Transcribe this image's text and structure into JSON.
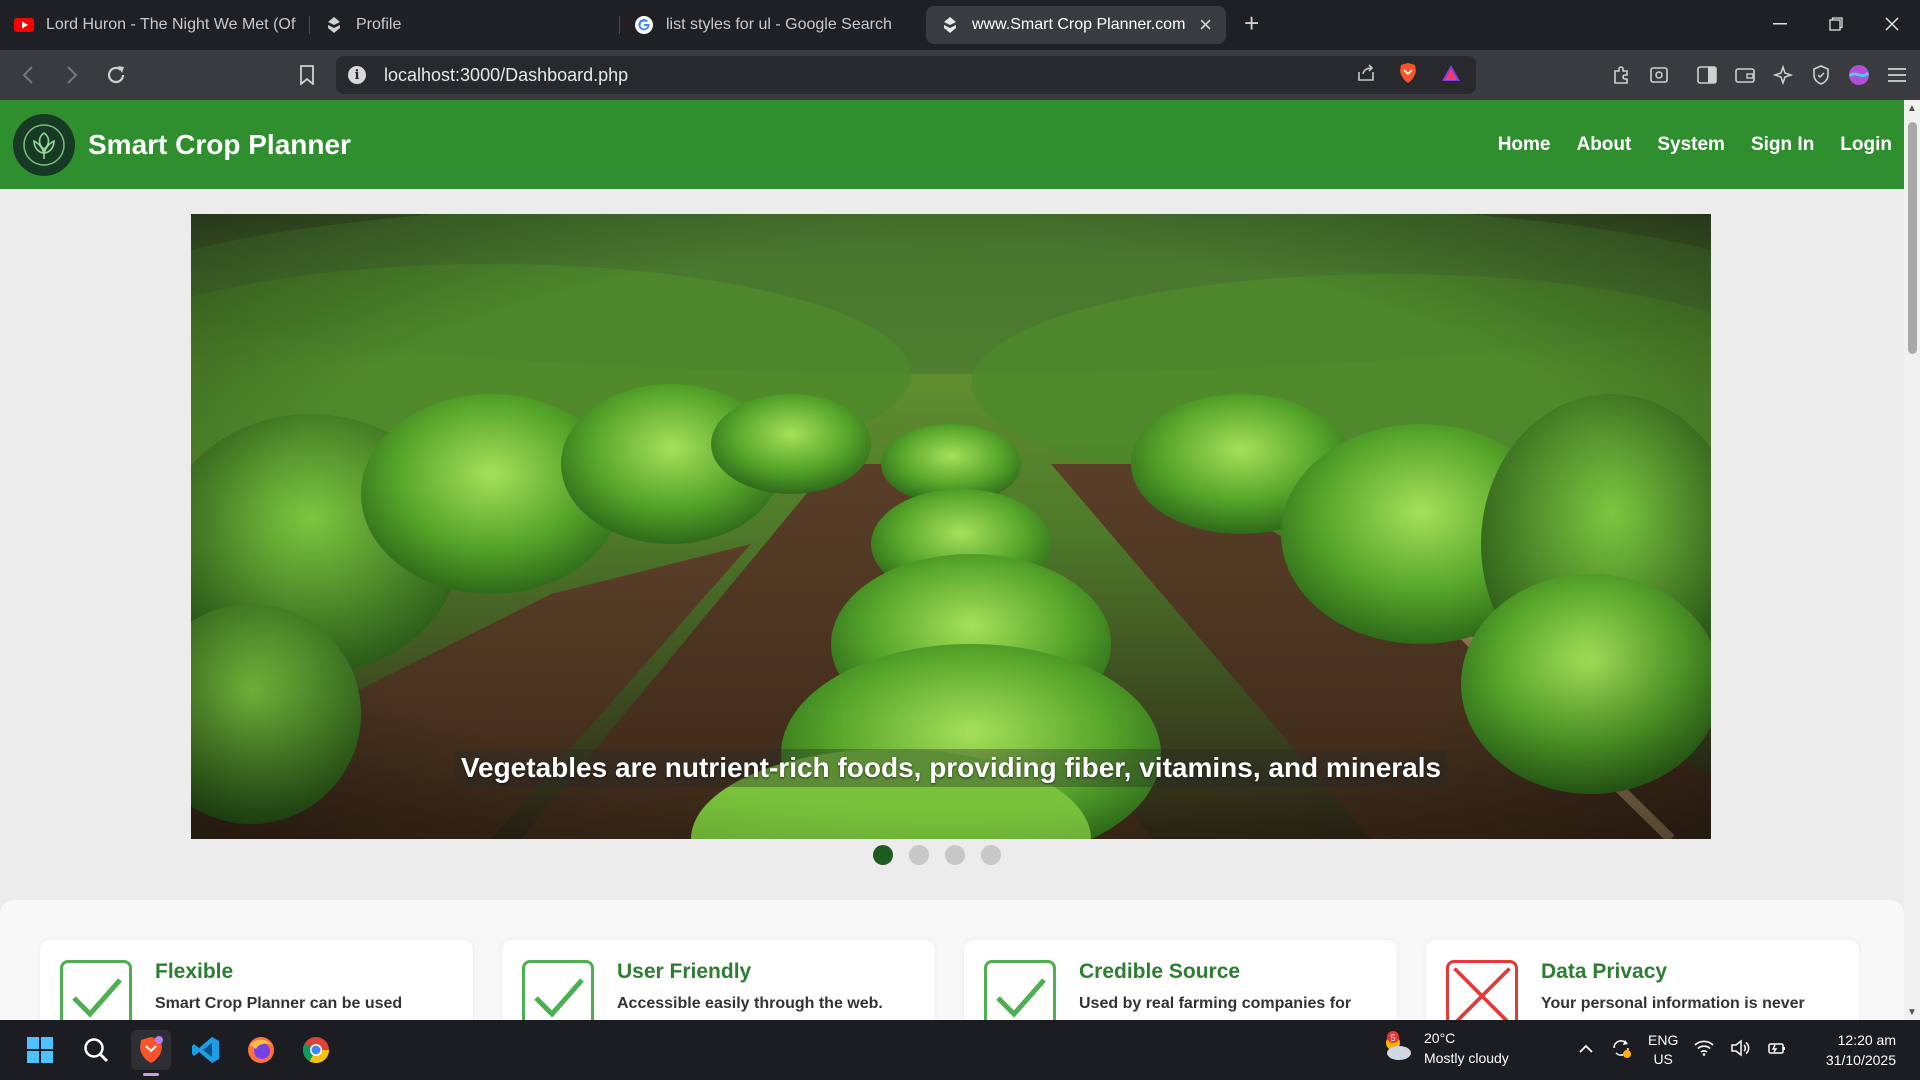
{
  "browser": {
    "tabs": [
      {
        "label": "Lord Huron - The Night We Met (Offi",
        "icon": "youtube-icon",
        "active": false
      },
      {
        "label": "Profile",
        "icon": "site-logo-icon",
        "active": false
      },
      {
        "label": "list styles for ul - Google Search",
        "icon": "google-icon",
        "active": false
      },
      {
        "label": "www.Smart Crop Planner.com",
        "icon": "site-logo-icon",
        "active": true
      }
    ],
    "new_tab": "+",
    "url": "localhost:3000/Dashboard.php"
  },
  "site": {
    "brand": "Smart Crop Planner",
    "menu": [
      "Home",
      "About",
      "System",
      "Sign In",
      "Login"
    ],
    "colors": {
      "nav": "#2f8f2f",
      "accent": "#2e7d32",
      "dot_active": "#1b5e20"
    }
  },
  "carousel": {
    "caption": "Vegetables are nutrient-rich foods, providing fiber, vitamins, and minerals",
    "slide_count": 4,
    "active_index": 0
  },
  "features": [
    {
      "title": "Flexible",
      "text": "Smart Crop Planner can be used",
      "icon": "check-icon"
    },
    {
      "title": "User Friendly",
      "text": "Accessible easily through the web.",
      "icon": "check-icon"
    },
    {
      "title": "Credible Source",
      "text": "Used by real farming companies for",
      "icon": "check-icon"
    },
    {
      "title": "Data Privacy",
      "text": "Your personal information is never",
      "icon": "cross-icon"
    }
  ],
  "taskbar": {
    "weather": {
      "temp": "20°C",
      "condition": "Mostly cloudy",
      "badge": "5"
    },
    "lang": {
      "line1": "ENG",
      "line2": "US"
    },
    "time": "12:20 am",
    "date": "31/10/2025"
  }
}
